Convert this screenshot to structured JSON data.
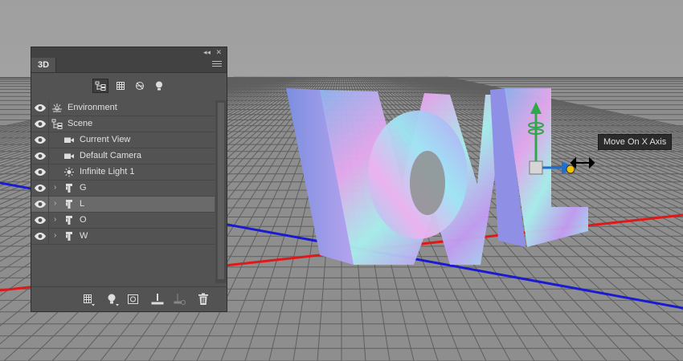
{
  "panel": {
    "tab_label": "3D",
    "collapse_glyph": "◂◂",
    "close_glyph": "✕",
    "filter_icons": [
      "scene-filter-icon",
      "mesh-filter-icon",
      "material-filter-icon",
      "light-filter-icon"
    ],
    "layers": [
      {
        "label": "Environment",
        "icon": "environment-icon",
        "expandable": false,
        "selected": false
      },
      {
        "label": "Scene",
        "icon": "scene-icon",
        "expandable": false,
        "selected": false
      },
      {
        "label": "Current View",
        "icon": "camera-icon",
        "expandable": false,
        "selected": false
      },
      {
        "label": "Default Camera",
        "icon": "camera-icon",
        "expandable": false,
        "selected": false
      },
      {
        "label": "Infinite Light 1",
        "icon": "light-icon",
        "expandable": false,
        "selected": false
      },
      {
        "label": "G",
        "icon": "mesh-icon",
        "expandable": true,
        "selected": false
      },
      {
        "label": "L",
        "icon": "mesh-icon",
        "expandable": true,
        "selected": true
      },
      {
        "label": "O",
        "icon": "mesh-icon",
        "expandable": true,
        "selected": false
      },
      {
        "label": "W",
        "icon": "mesh-icon",
        "expandable": true,
        "selected": false
      }
    ],
    "bottom_icons": [
      "new-mesh-icon",
      "new-light-icon",
      "new-material-icon",
      "drop-to-plane-icon",
      "render-icon",
      "trash-icon"
    ]
  },
  "viewport": {
    "tooltip": "Move On X Axis"
  },
  "colors": {
    "panel_bg": "#535353",
    "viewport_bg": "#a6a6a6",
    "x_axis": "#e01818",
    "z_axis": "#1a1ad0",
    "y_gizmo": "#2ea84a",
    "x_gizmo": "#1e6fd0"
  }
}
